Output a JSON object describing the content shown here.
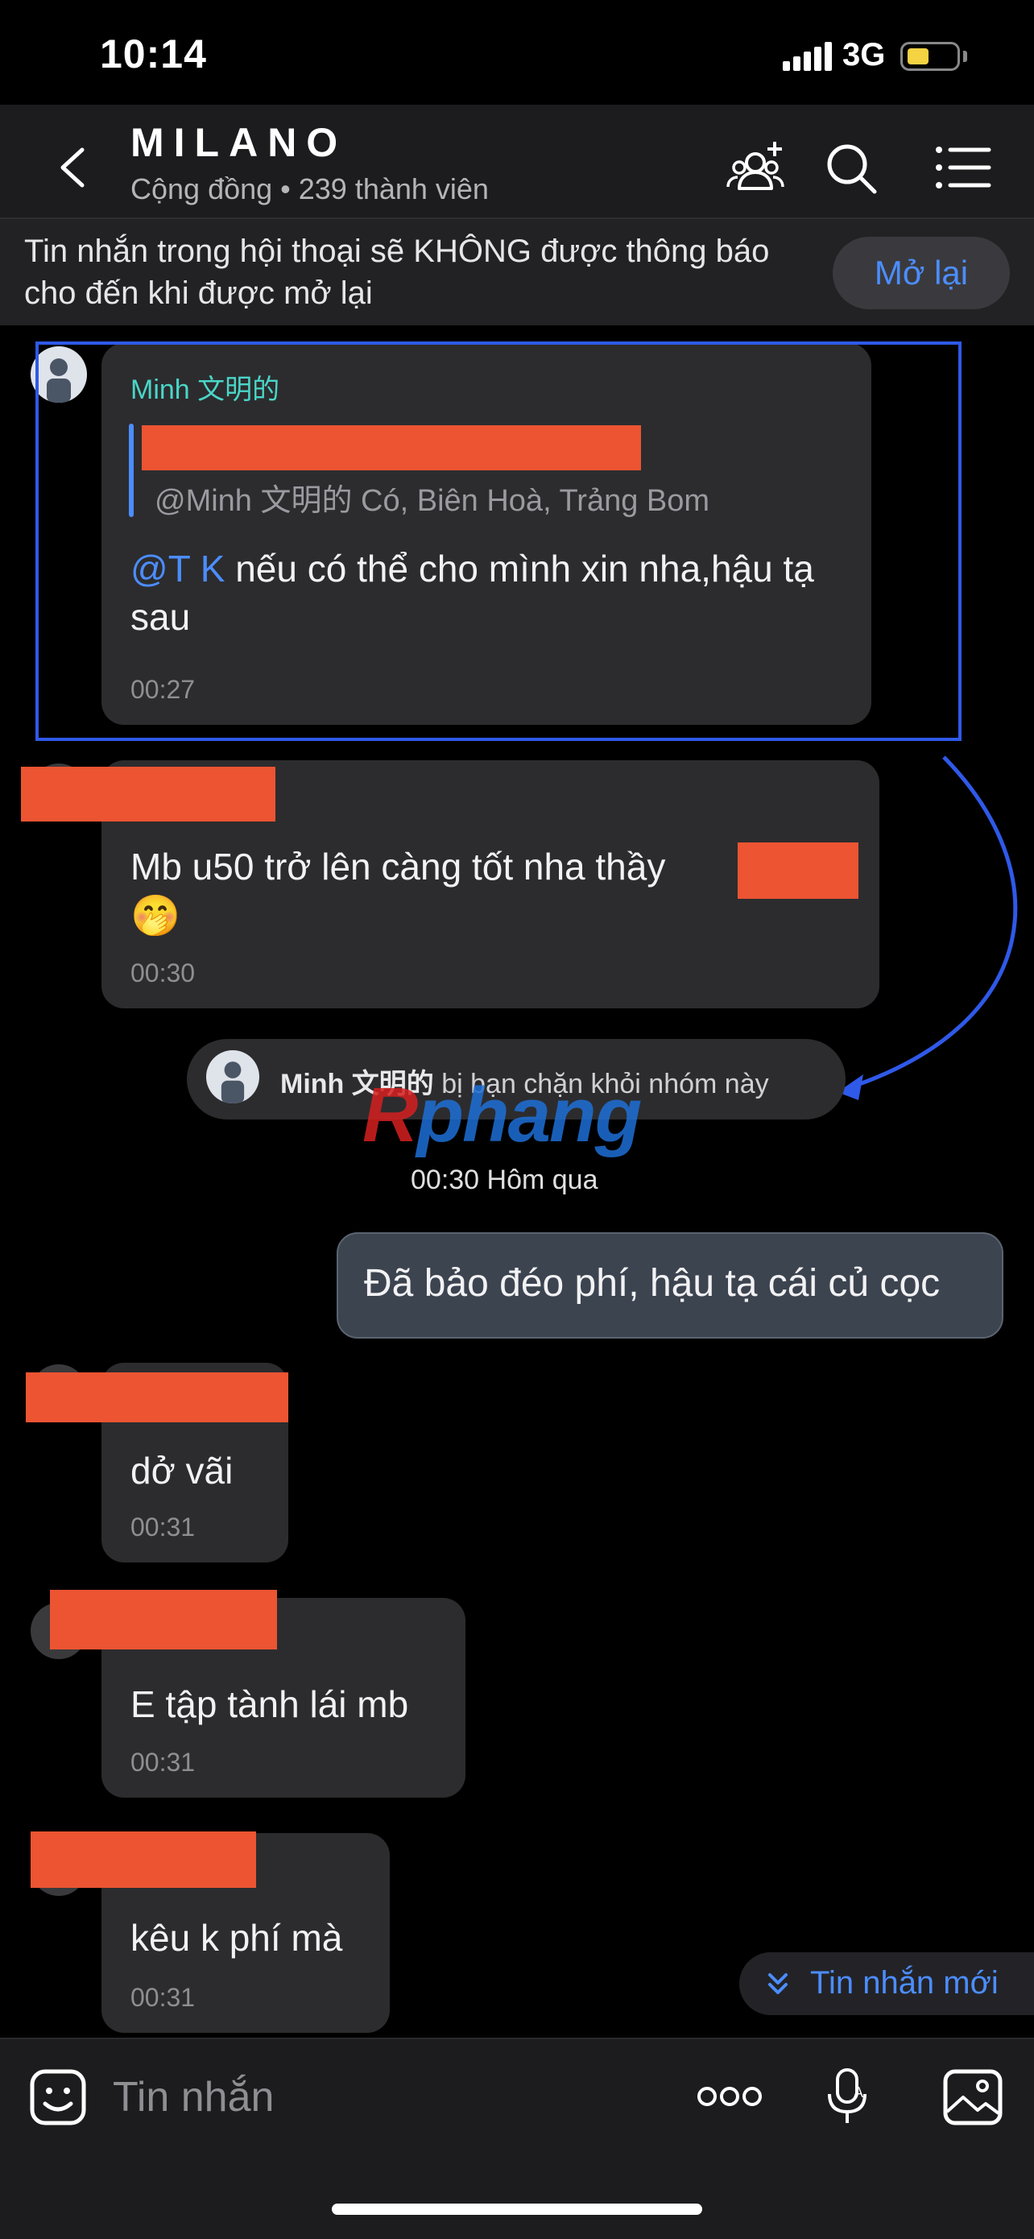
{
  "status_bar": {
    "time": "10:14",
    "network": "3G",
    "battery_color": "#f5d342"
  },
  "header": {
    "title": "MILANO",
    "subtitle": "Cộng đồng • 239 thành viên",
    "icons": [
      "back-chevron-icon",
      "add-member-icon",
      "search-icon",
      "menu-list-icon"
    ]
  },
  "banner": {
    "text": "Tin nhắn trong hội thoại sẽ KHÔNG được thông báo cho đến khi được mở lại",
    "button": "Mở lại"
  },
  "messages": [
    {
      "sender": "Minh 文明的",
      "quote": "@Minh 文明的 Có, Biên Hoà, Trảng Bom",
      "mention": "@T K",
      "text": " nếu có thể cho mình xin nha,hậu tạ sau",
      "time": "00:27"
    },
    {
      "text": "Mb u50 trở lên càng tốt nha thầy",
      "emoji": "🤭",
      "time": "00:30"
    }
  ],
  "system_notice": {
    "name": "Minh 文明的",
    "text": " bị bạn chặn khỏi nhóm này"
  },
  "watermark": {
    "part1": "R",
    "part2": "phang"
  },
  "date_separator": "00:30 Hôm qua",
  "outgoing": {
    "text": "Đã bảo đéo phí, hậu tạ cái củ cọc"
  },
  "replies": [
    {
      "text": "dở vãi",
      "time": "00:31"
    },
    {
      "text": "E tập tành lái mb",
      "time": "00:31"
    },
    {
      "text": "kêu k phí mà",
      "time": "00:31"
    }
  ],
  "new_messages": "Tin nhắn mới",
  "composer": {
    "placeholder": "Tin nhắn",
    "icons": [
      "sticker-icon",
      "more-icon",
      "voice-icon",
      "image-icon"
    ]
  },
  "colors": {
    "accent": "#4c8dff",
    "redaction": "#ec5432",
    "highlight": "#2f59e8",
    "sender": "#4ad6c8"
  }
}
